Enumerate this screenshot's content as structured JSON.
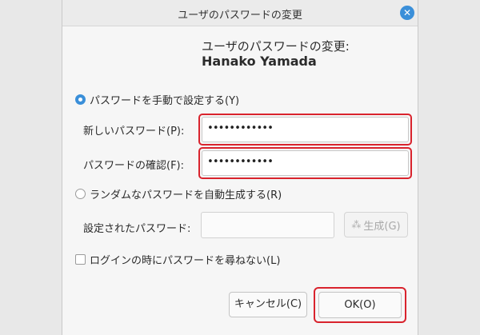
{
  "window": {
    "title": "ユーザのパスワードの変更",
    "close_glyph": "✕"
  },
  "header": {
    "heading": "ユーザのパスワードの変更:",
    "username": "Hanako Yamada"
  },
  "manual": {
    "label": "パスワードを手動で設定する(Y)",
    "selected": true,
    "new_password_label": "新しいパスワード(P):",
    "new_password_value": "••••••••••••",
    "confirm_label": "パスワードの確認(F):",
    "confirm_value": "••••••••••••"
  },
  "auto": {
    "label": "ランダムなパスワードを自動生成する(R)",
    "selected": false,
    "set_password_label": "設定されたパスワード:",
    "set_password_value": "",
    "generate_label": "生成(G)",
    "generate_icon": "dice-icon"
  },
  "no_ask": {
    "label": "ログインの時にパスワードを尋ねない(L)",
    "checked": false
  },
  "buttons": {
    "cancel": "キャンセル(C)",
    "ok": "OK(O)"
  },
  "colors": {
    "accent": "#3a8fd9",
    "highlight": "#d9232d"
  }
}
